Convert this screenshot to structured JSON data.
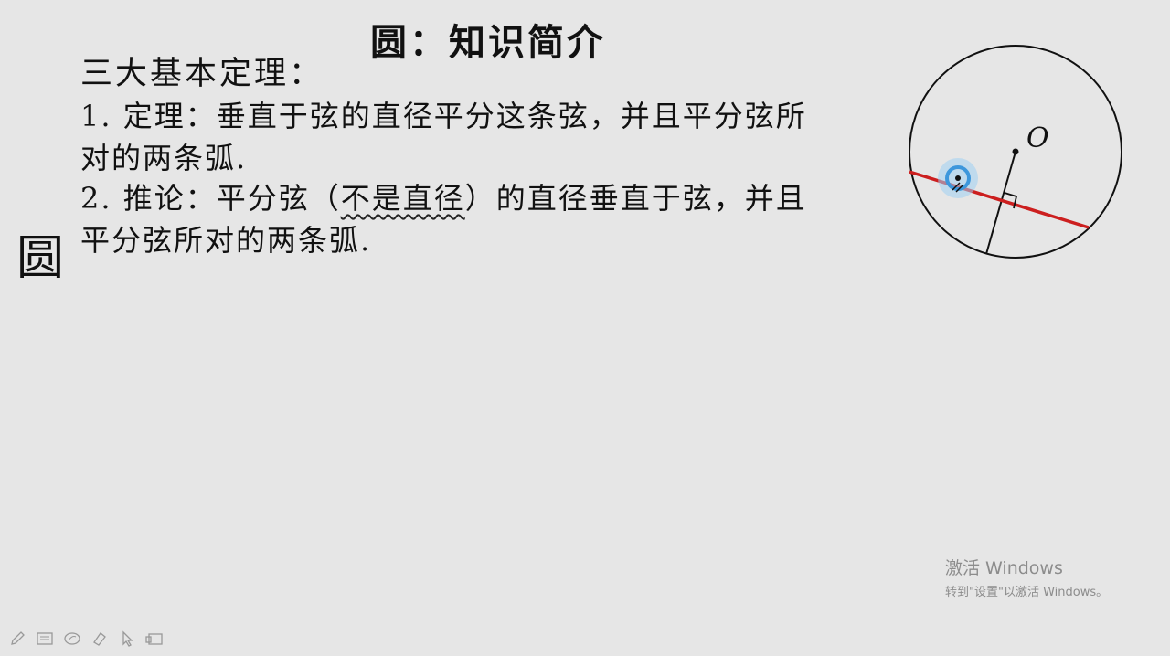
{
  "slide": {
    "title": "圆：知识简介",
    "side_char": "圆",
    "subtitle": "三大基本定理：",
    "lines": {
      "l1": "1.  定理：垂直于弦的直径平分这条弦，并且平分弦所",
      "l2": "对的两条弧.",
      "l3_prefix": "2.  推论：平分弦（",
      "l3_wavy": "不是直径",
      "l3_suffix": "）的直径垂直于弦，并且",
      "l4": "平分弦所对的两条弧."
    },
    "diagram": {
      "center_label": "O",
      "chord_color": "#cc1f1f",
      "cursor_color": "#4aa3e0"
    }
  },
  "watermark": {
    "line1": "激活 Windows",
    "line2": "转到\"设置\"以激活 Windows。"
  },
  "toolbar": {
    "icons": [
      "pen-icon",
      "slides-icon",
      "eraser-icon",
      "highlighter-icon",
      "pointer-icon",
      "screen-icon"
    ]
  }
}
